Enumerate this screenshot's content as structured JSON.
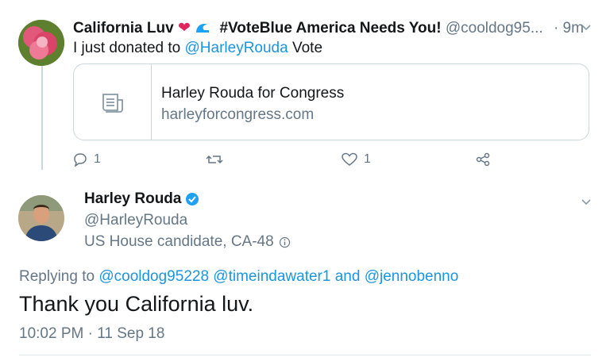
{
  "tweet1": {
    "display_name": "California Luv",
    "name_suffix": "#VoteBlue America Needs You!",
    "handle": "@cooldog95...",
    "time": "· 9m",
    "text_prefix": "I just donated to",
    "text_mention": "@HarleyRouda",
    "text_suffix": "Vote",
    "card": {
      "title": "Harley Rouda for Congress",
      "url": "harleyforcongress.com"
    },
    "actions": {
      "reply_count": "1",
      "like_count": "1"
    }
  },
  "tweet2": {
    "display_name": "Harley Rouda",
    "handle": "@HarleyRouda",
    "bio": "US House candidate, CA-48",
    "replying_label": "Replying to",
    "replying_mentions": "@cooldog95228 @timeindawater1",
    "replying_and": "and",
    "replying_last": "@jennobenno",
    "text": "Thank you California luv.",
    "timestamp": "10:02 PM · 11 Sep 18"
  },
  "colors": {
    "accent": "#1b95e0",
    "muted": "#657786",
    "heart": "#e0245e",
    "wave": "#1da1f2"
  }
}
